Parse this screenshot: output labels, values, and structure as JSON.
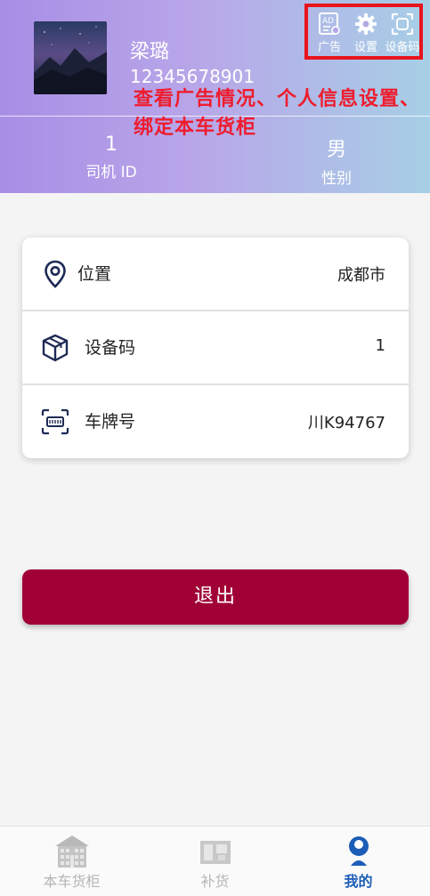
{
  "profile": {
    "name": "梁璐",
    "phone": "12345678901"
  },
  "stats": [
    {
      "value": "1",
      "label": "司机 ID"
    },
    {
      "value": "男",
      "label": "性别"
    }
  ],
  "top_actions": [
    {
      "label": "广告",
      "icon": "ad-icon"
    },
    {
      "label": "设置",
      "icon": "gear-icon"
    },
    {
      "label": "设备码",
      "icon": "scan-icon"
    }
  ],
  "annotation": "查看广告情况、个人信息设置、绑定本车货柜",
  "info_rows": [
    {
      "label": "位置",
      "value": "成都市",
      "icon": "location-pin-icon"
    },
    {
      "label": "设备码",
      "value": "1",
      "icon": "package-box-icon"
    },
    {
      "label": "车牌号",
      "value": "川K94767",
      "icon": "license-plate-icon"
    }
  ],
  "logout_label": "退出",
  "nav": [
    {
      "label": "本车货柜",
      "icon": "cabinet-icon",
      "active": false
    },
    {
      "label": "补货",
      "icon": "restock-icon",
      "active": false
    },
    {
      "label": "我的",
      "icon": "profile-icon",
      "active": true
    }
  ],
  "colors": {
    "accent": "#a00035",
    "active_nav": "#1c5db8",
    "inactive_nav": "#b5b5b5",
    "annotation": "#ee1c2e",
    "highlight_box": "#e8141c"
  }
}
